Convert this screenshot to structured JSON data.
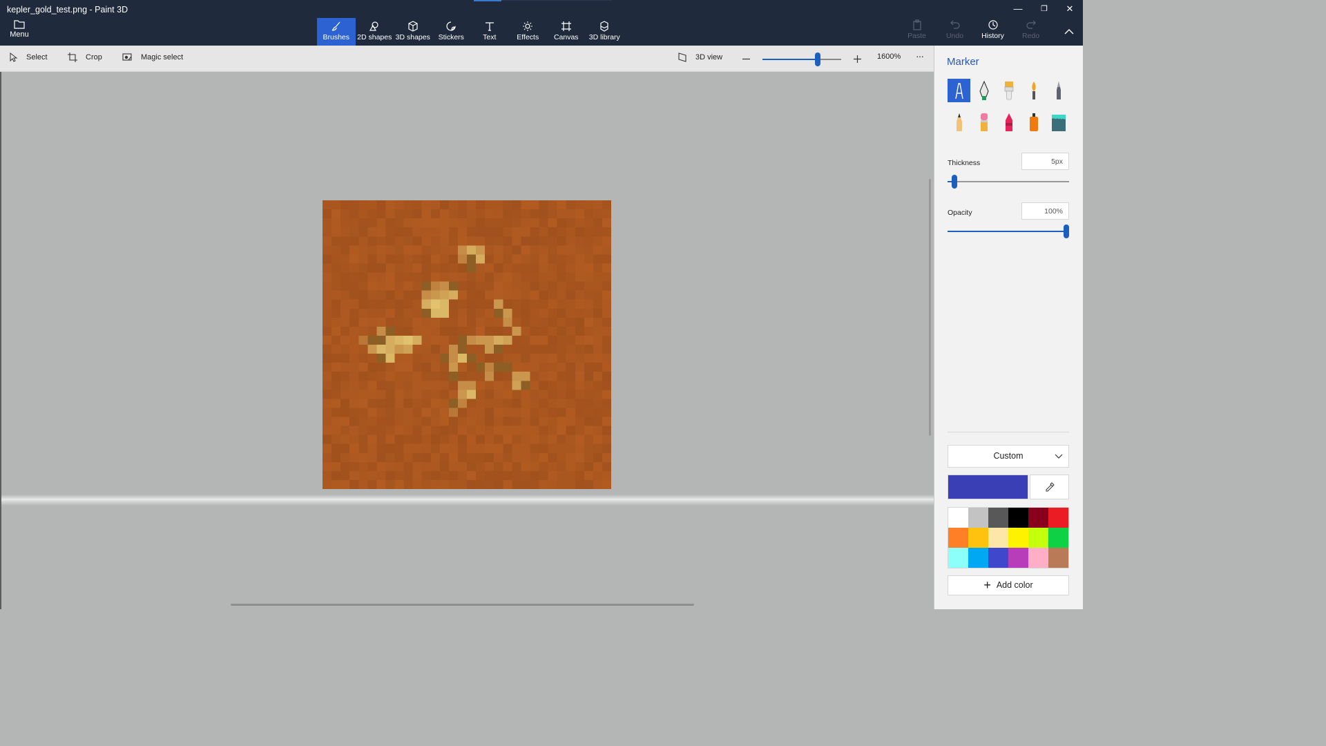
{
  "window": {
    "title": "kepler_gold_test.png - Paint 3D",
    "controls": {
      "minimize": "—",
      "restore": "❐",
      "close": "✕"
    }
  },
  "menu": {
    "label": "Menu",
    "icon": "folder-icon"
  },
  "tabs": [
    {
      "label": "Brushes",
      "icon": "brush-icon",
      "active": true
    },
    {
      "label": "2D shapes",
      "icon": "2d-shapes-icon",
      "active": false
    },
    {
      "label": "3D shapes",
      "icon": "cube-icon",
      "active": false
    },
    {
      "label": "Stickers",
      "icon": "sticker-icon",
      "active": false
    },
    {
      "label": "Text",
      "icon": "text-icon",
      "active": false
    },
    {
      "label": "Effects",
      "icon": "sun-icon",
      "active": false
    },
    {
      "label": "Canvas",
      "icon": "canvas-icon",
      "active": false
    },
    {
      "label": "3D library",
      "icon": "3d-library-icon",
      "active": false
    }
  ],
  "actions": {
    "paste": "Paste",
    "undo": "Undo",
    "history": "History",
    "redo": "Redo"
  },
  "toolbar": {
    "select": "Select",
    "crop": "Crop",
    "magic_select": "Magic select",
    "view_3d": "3D view",
    "zoom_level": "1600%",
    "zoom_value_fraction": 0.7,
    "more": "···"
  },
  "panel": {
    "title": "Marker",
    "tools_row1": [
      "marker-icon",
      "calligraphy-pen-icon",
      "oil-brush-icon",
      "watercolor-icon",
      "pixel-pen-icon"
    ],
    "tools_row2": [
      "pencil-icon",
      "eraser-icon",
      "crayon-icon",
      "spray-can-icon",
      "fill-bucket-icon"
    ],
    "active_tool": "marker-icon",
    "thickness_label": "Thickness",
    "thickness_value": "5px",
    "thickness_fraction": 0.05,
    "opacity_label": "Opacity",
    "opacity_value": "100%",
    "opacity_fraction": 1.0,
    "color_mode": "Custom",
    "current_color": "#3a3fb5",
    "add_color": "Add color",
    "palette": [
      "#ffffff",
      "#c3c3c3",
      "#585858",
      "#000000",
      "#88001b",
      "#ec1c24",
      "#ff7f27",
      "#ffc20e",
      "#fde7a8",
      "#fff200",
      "#c4ff0e",
      "#0ed145",
      "#8cfffb",
      "#00a8f3",
      "#3f48cc",
      "#b83dba",
      "#ffaec8",
      "#b97a57"
    ]
  },
  "image": {
    "base_color": "#a9561f",
    "accent_colors": [
      "#c9a23b",
      "#ddc070",
      "#8e5f25",
      "#b98a32"
    ]
  }
}
